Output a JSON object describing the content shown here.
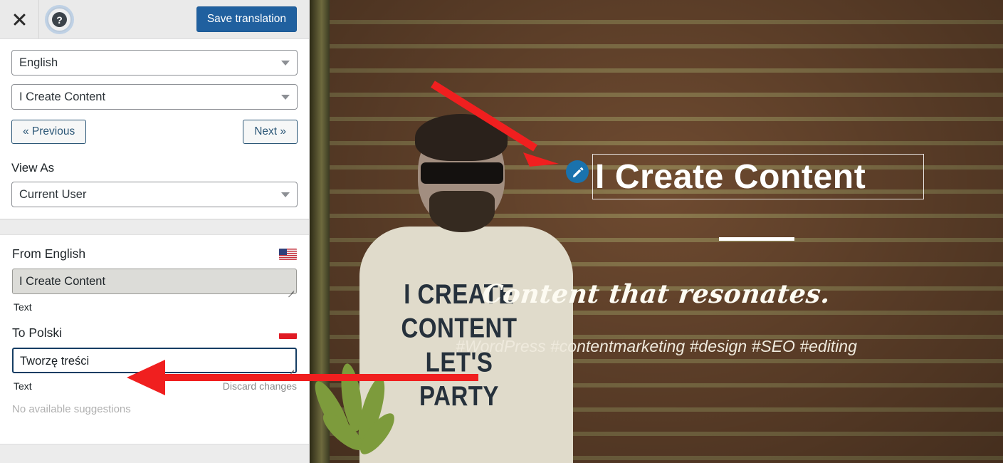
{
  "header": {
    "close_icon": "close-icon",
    "help_icon": "help-icon",
    "help_glyph": "?",
    "save_label": "Save translation"
  },
  "nav": {
    "language_select": {
      "value": "English",
      "caret_icon": "chevron-down-icon"
    },
    "string_select": {
      "value": "I Create Content",
      "caret_icon": "chevron-down-icon"
    },
    "previous_label": "« Previous",
    "next_label": "Next »",
    "view_as_label": "View As",
    "view_as_select": {
      "value": "Current User",
      "caret_icon": "chevron-down-icon"
    }
  },
  "translate": {
    "source": {
      "title": "From English",
      "flag_icon": "flag-us-icon",
      "value": "I Create Content",
      "meta_label": "Text"
    },
    "target": {
      "title": "To Polski",
      "flag_icon": "flag-pl-icon",
      "value": "Tworzę treści",
      "meta_label": "Text",
      "discard_label": "Discard changes"
    },
    "suggestions_empty": "No available suggestions"
  },
  "preview": {
    "hero_title": "I Create Content",
    "edit_icon": "pencil-icon",
    "tagline": "Content that resonates.",
    "hashtags": "#WordPress #contentmarketing #design #SEO #editing",
    "shirt_text": "I CREATE CONTENT LET'S PARTY"
  },
  "annotations": {
    "arrow_to_pencil": "red-arrow-icon",
    "arrow_to_target_field": "red-arrow-icon"
  },
  "colors": {
    "accent_blue": "#20609f",
    "button_border": "#2c5777",
    "focus_border": "#153d63",
    "annotation_red": "#f01f1f",
    "pencil_blue": "#1a72ad",
    "header_bg": "#eaeaea"
  }
}
